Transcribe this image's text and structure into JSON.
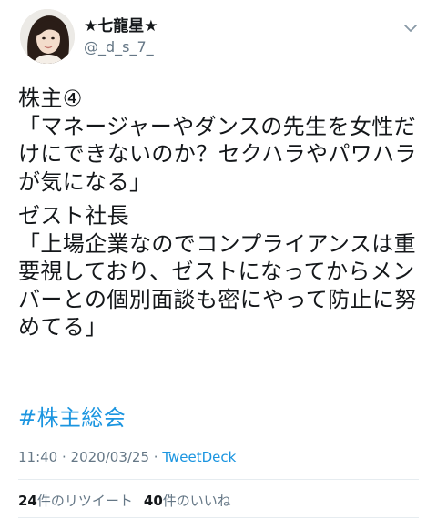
{
  "tweet": {
    "author": {
      "display_name": "★七龍星★",
      "handle": "@_d_s_7_",
      "avatar_icon": "profile-photo"
    },
    "menu_icon": "chevron-down-icon",
    "paragraphs": [
      "株主④\n「マネージャーやダンスの先生を女性だけにできないのか？セクハラやパワハラが気になる」",
      "ゼスト社長\n「上場企業なのでコンプライアンスは重要視しており、ゼストになってからメンバーとの個別面談も密にやって防止に努めてる」"
    ],
    "hashtag": "#株主総会",
    "time": "11:40",
    "separator": " · ",
    "date": "2020/03/25",
    "source": "TweetDeck",
    "stats": {
      "retweets_count": "24",
      "retweets_label": "件のリツイート",
      "likes_count": "40",
      "likes_label": "件のいいね"
    },
    "colors": {
      "text": "#14171a",
      "secondary": "#657786",
      "link": "#1b95e0",
      "divider": "#e6ecf0"
    }
  }
}
